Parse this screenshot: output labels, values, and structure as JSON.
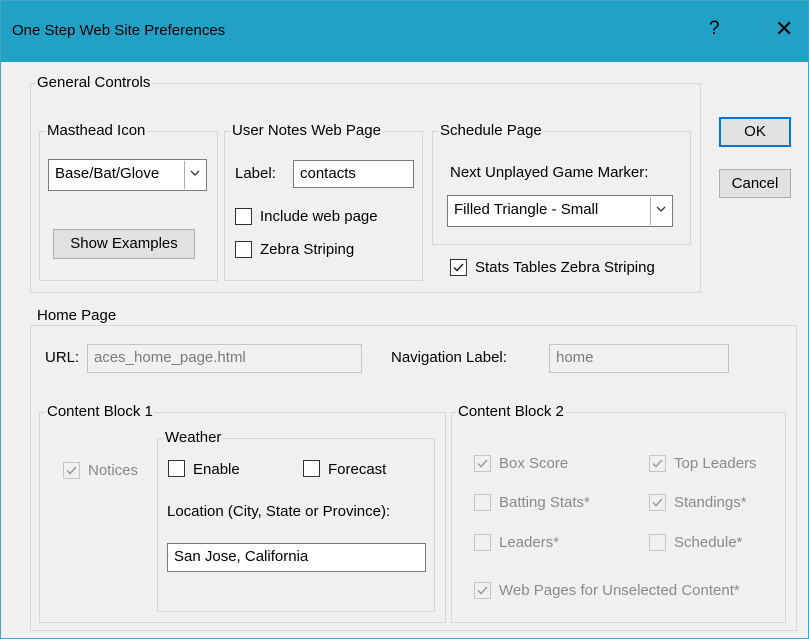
{
  "window": {
    "title": "One Step Web Site Preferences",
    "help_glyph": "?",
    "close_glyph": "✕"
  },
  "buttons": {
    "ok": "OK",
    "cancel": "Cancel"
  },
  "general_controls": {
    "legend": "General Controls",
    "masthead": {
      "legend": "Masthead Icon",
      "selected": "Base/Bat/Glove",
      "show_examples": "Show Examples"
    },
    "user_notes": {
      "legend": "User Notes Web Page",
      "label_caption": "Label:",
      "label_value": "contacts",
      "include_web_page": {
        "label": "Include web page",
        "checked": false
      },
      "zebra_striping": {
        "label": "Zebra Striping",
        "checked": false
      }
    },
    "schedule": {
      "legend": "Schedule Page",
      "marker_caption": "Next Unplayed Game Marker:",
      "marker_selected": "Filled Triangle - Small"
    },
    "stats_zebra": {
      "label": "Stats Tables Zebra Striping",
      "checked": true
    }
  },
  "home_page": {
    "legend": "Home Page",
    "url_caption": "URL:",
    "url_value": "aces_home_page.html",
    "nav_caption": "Navigation Label:",
    "nav_value": "home",
    "content_block_1": {
      "legend": "Content Block 1",
      "notices": {
        "label": "Notices",
        "checked": true,
        "enabled": false
      },
      "weather": {
        "legend": "Weather",
        "enable": {
          "label": "Enable",
          "checked": false
        },
        "forecast": {
          "label": "Forecast",
          "checked": false
        },
        "location_caption": "Location (City, State or Province):",
        "location_value": "San Jose, California"
      }
    },
    "content_block_2": {
      "legend": "Content Block 2",
      "box_score": {
        "label": "Box Score",
        "checked": true
      },
      "top_leaders": {
        "label": "Top Leaders",
        "checked": true
      },
      "batting_stats": {
        "label": "Batting Stats*",
        "checked": false
      },
      "standings": {
        "label": "Standings*",
        "checked": true
      },
      "leaders": {
        "label": "Leaders*",
        "checked": false
      },
      "schedule": {
        "label": "Schedule*",
        "checked": false
      },
      "web_pages_unselected": {
        "label": "Web Pages for Unselected Content*",
        "checked": true
      }
    }
  }
}
